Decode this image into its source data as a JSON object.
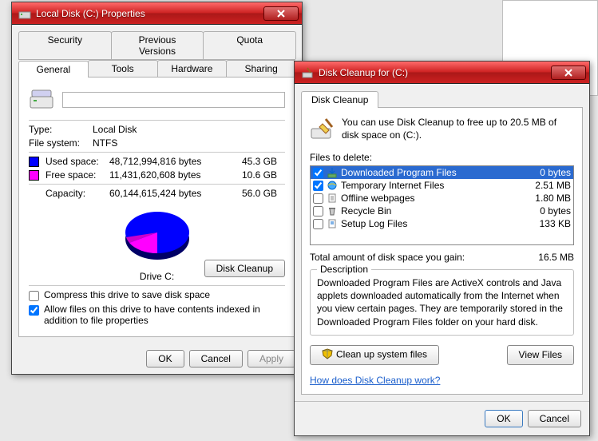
{
  "props": {
    "title": "Local Disk (C:) Properties",
    "tabs_upper": [
      "Security",
      "Previous Versions",
      "Quota"
    ],
    "tabs_lower": [
      "General",
      "Tools",
      "Hardware",
      "Sharing"
    ],
    "active_tab": "General",
    "name_value": "",
    "type_label": "Type:",
    "type_value": "Local Disk",
    "fs_label": "File system:",
    "fs_value": "NTFS",
    "used_label": "Used space:",
    "used_bytes": "48,712,994,816 bytes",
    "used_human": "45.3 GB",
    "used_color": "#0000ff",
    "free_label": "Free space:",
    "free_bytes": "11,431,620,608 bytes",
    "free_human": "10.6 GB",
    "free_color": "#ff00ff",
    "capacity_label": "Capacity:",
    "capacity_bytes": "60,144,615,424 bytes",
    "capacity_human": "56.0 GB",
    "drive_caption": "Drive C:",
    "disk_cleanup_btn": "Disk Cleanup",
    "compress_cb": "Compress this drive to save disk space",
    "compress_checked": false,
    "index_cb": "Allow files on this drive to have contents indexed in addition to file properties",
    "index_checked": true,
    "ok": "OK",
    "cancel": "Cancel",
    "apply": "Apply"
  },
  "cleanup": {
    "title": "Disk Cleanup for  (C:)",
    "tab": "Disk Cleanup",
    "intro": "You can use Disk Cleanup to free up to 20.5 MB of disk space on  (C:).",
    "files_to_delete": "Files to delete:",
    "items": [
      {
        "checked": true,
        "selected": true,
        "icon": "download-icon",
        "name": "Downloaded Program Files",
        "size": "0 bytes"
      },
      {
        "checked": true,
        "selected": false,
        "icon": "ie-icon",
        "name": "Temporary Internet Files",
        "size": "2.51 MB"
      },
      {
        "checked": false,
        "selected": false,
        "icon": "page-icon",
        "name": "Offline webpages",
        "size": "1.80 MB"
      },
      {
        "checked": false,
        "selected": false,
        "icon": "bin-icon",
        "name": "Recycle Bin",
        "size": "0 bytes"
      },
      {
        "checked": false,
        "selected": false,
        "icon": "log-icon",
        "name": "Setup Log Files",
        "size": "133 KB"
      }
    ],
    "total_label": "Total amount of disk space you gain:",
    "total_value": "16.5 MB",
    "desc_legend": "Description",
    "desc_text": "Downloaded Program Files are ActiveX controls and Java applets downloaded automatically from the Internet when you view certain pages. They are temporarily stored in the Downloaded Program Files folder on your hard disk.",
    "clean_sys_btn": "Clean up system files",
    "view_files_btn": "View Files",
    "help_link": "How does Disk Cleanup work?",
    "ok": "OK",
    "cancel": "Cancel"
  }
}
